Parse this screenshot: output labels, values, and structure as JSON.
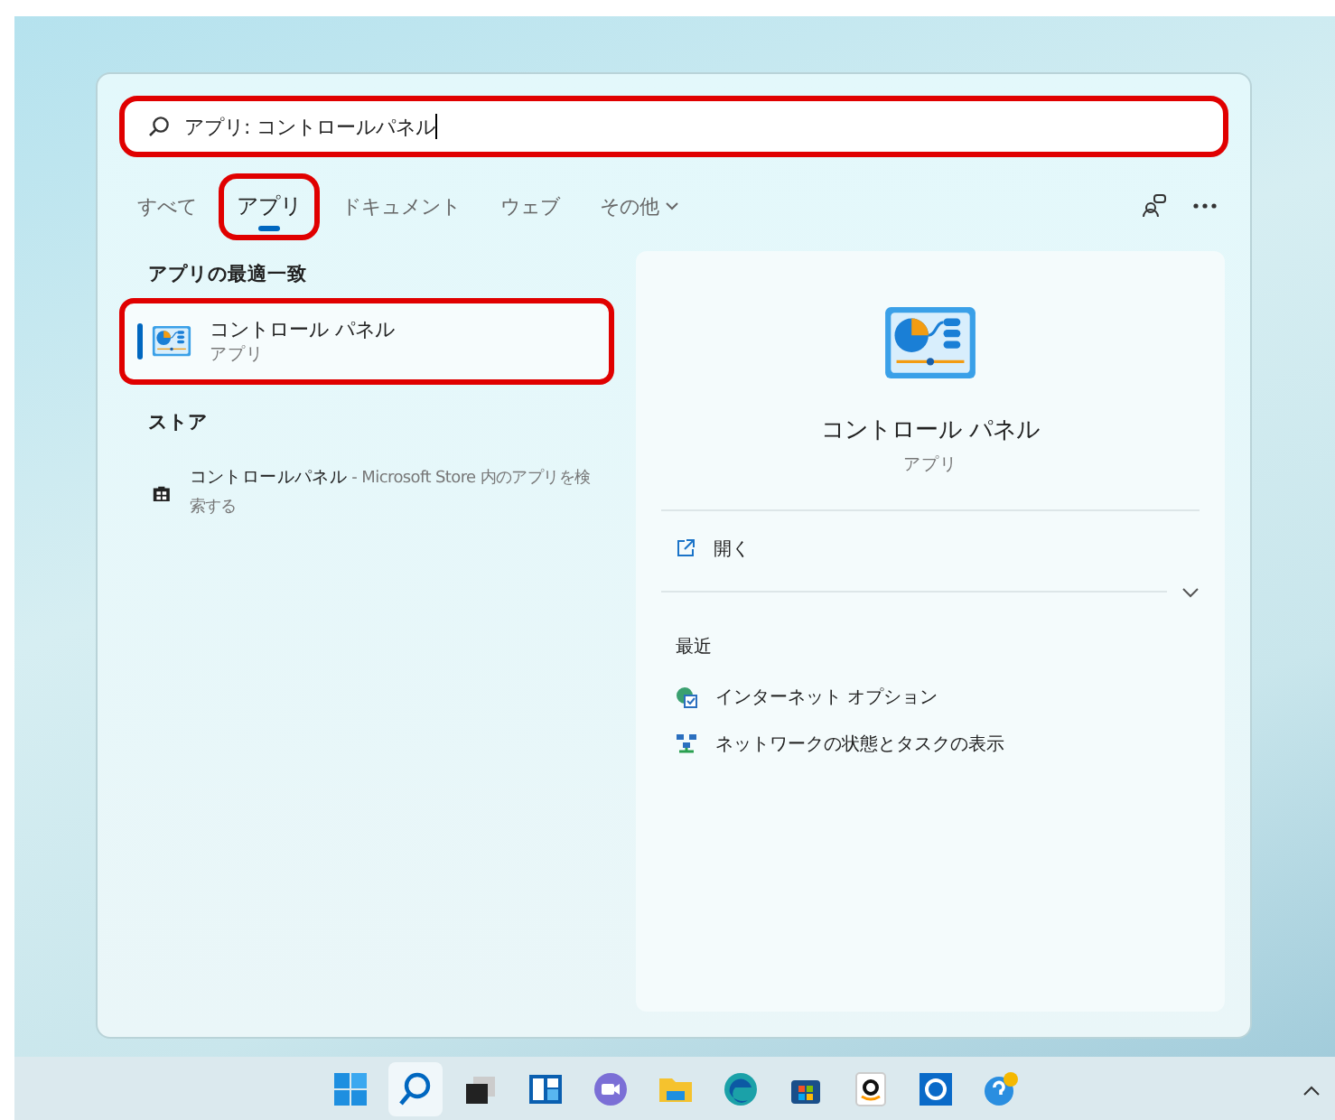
{
  "search": {
    "value": "アプリ: コントロールパネル",
    "highlighted": true
  },
  "tabs": [
    {
      "label": "すべて",
      "selected": false,
      "highlighted": false
    },
    {
      "label": "アプリ",
      "selected": true,
      "highlighted": true
    },
    {
      "label": "ドキュメント",
      "selected": false,
      "highlighted": false
    },
    {
      "label": "ウェブ",
      "selected": false,
      "highlighted": false
    },
    {
      "label": "その他",
      "selected": false,
      "highlighted": false,
      "kind": "dropdown"
    }
  ],
  "results": [
    {
      "heading": "アプリの最適一致",
      "items": [
        {
          "kind": "app",
          "title": "コントロール パネル",
          "subtitle": "アプリ",
          "selected": true,
          "highlighted": true
        }
      ]
    },
    {
      "heading": "ストア",
      "items": [
        {
          "kind": "store",
          "title": "コントロールパネル",
          "subtitle": " - Microsoft Store 内のアプリを検索する",
          "selected": false,
          "highlighted": false
        }
      ]
    }
  ],
  "preview": {
    "title": "コントロール パネル",
    "subtitle": "アプリ",
    "actions": [
      {
        "label": "開く"
      }
    ],
    "recent_heading": "最近",
    "recent": [
      {
        "kind": "internet",
        "label": "インターネット オプション"
      },
      {
        "kind": "network",
        "label": "ネットワークの状態とタスクの表示"
      }
    ]
  },
  "taskbar": [
    {
      "kind": "start",
      "selected": false
    },
    {
      "kind": "search",
      "selected": true
    },
    {
      "kind": "taskview",
      "selected": false
    },
    {
      "kind": "widgets",
      "selected": false
    },
    {
      "kind": "chat",
      "selected": false
    },
    {
      "kind": "explorer",
      "selected": false
    },
    {
      "kind": "edge",
      "selected": false
    },
    {
      "kind": "store",
      "selected": false
    },
    {
      "kind": "amazon",
      "selected": false
    },
    {
      "kind": "app",
      "selected": false
    },
    {
      "kind": "help",
      "selected": false
    }
  ]
}
